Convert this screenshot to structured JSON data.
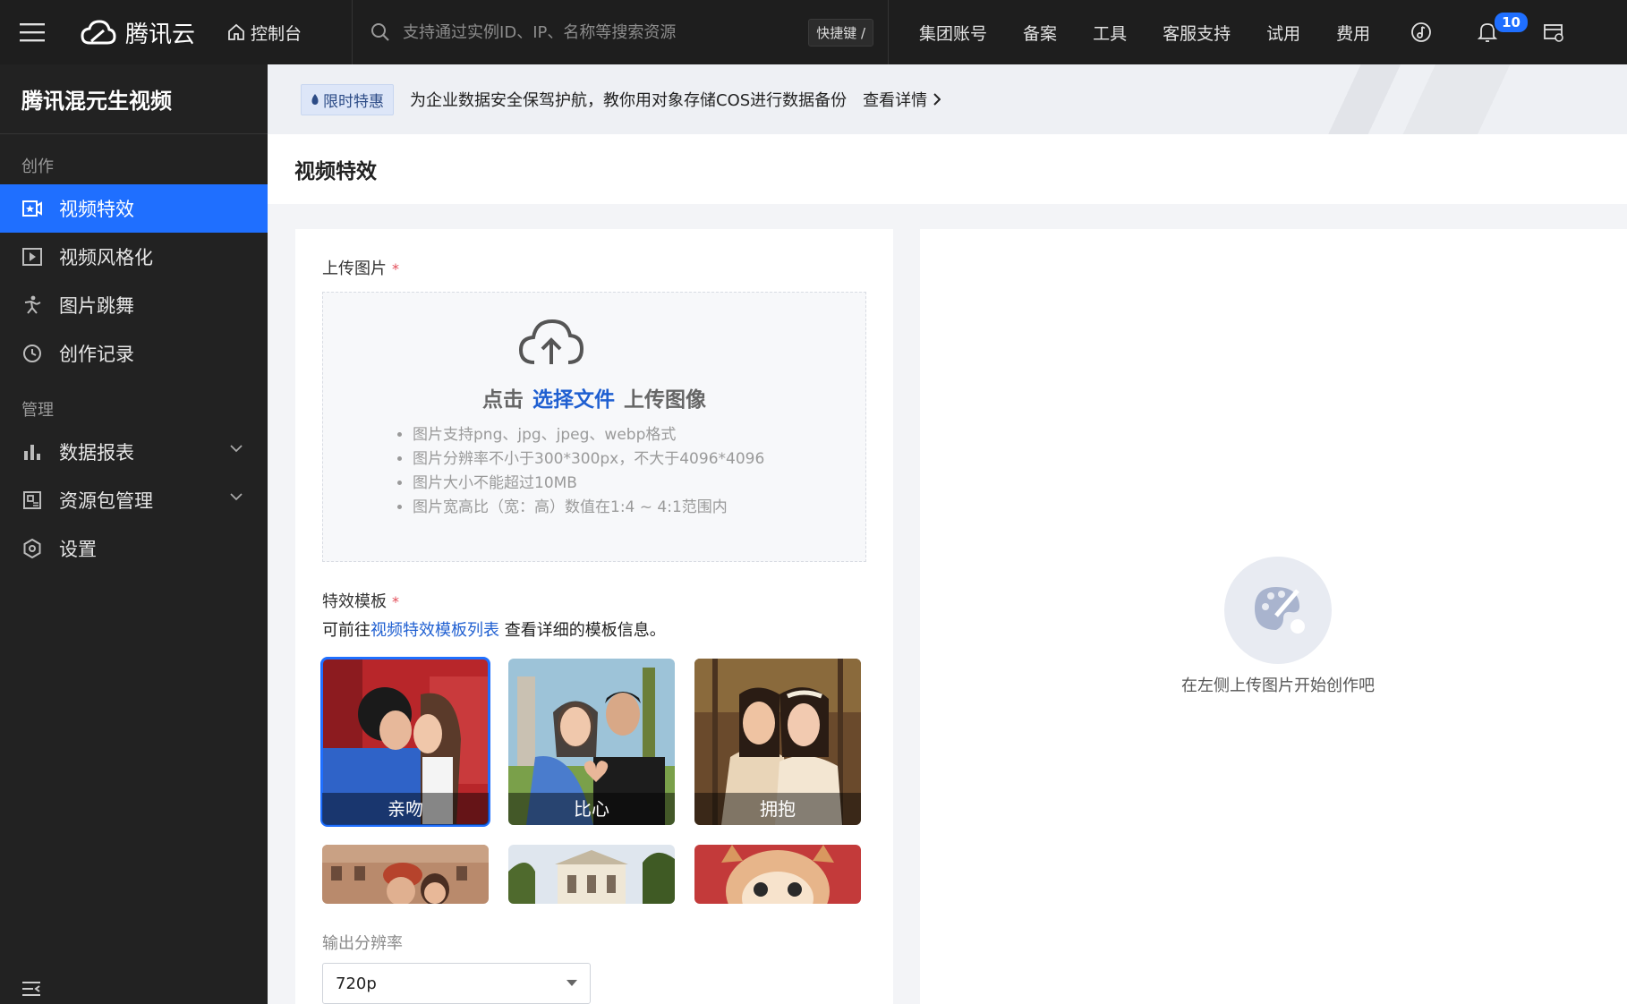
{
  "topbar": {
    "logo_text": "腾讯云",
    "console_label": "控制台",
    "search_placeholder": "支持通过实例ID、IP、名称等搜索资源",
    "shortcut_label": "快捷键 /",
    "nav": [
      "集团账号",
      "备案",
      "工具",
      "客服支持",
      "试用",
      "费用"
    ],
    "notification_count": "10"
  },
  "sidebar": {
    "title": "腾讯混元生视频",
    "group_create": "创作",
    "items_create": [
      {
        "label": "视频特效",
        "icon": "video-effect-icon",
        "active": true
      },
      {
        "label": "视频风格化",
        "icon": "video-play-icon",
        "active": false
      },
      {
        "label": "图片跳舞",
        "icon": "dancer-icon",
        "active": false
      },
      {
        "label": "创作记录",
        "icon": "history-icon",
        "active": false
      }
    ],
    "group_manage": "管理",
    "items_manage": [
      {
        "label": "数据报表",
        "icon": "bar-chart-icon",
        "expandable": true
      },
      {
        "label": "资源包管理",
        "icon": "package-icon",
        "expandable": true
      },
      {
        "label": "设置",
        "icon": "settings-icon",
        "expandable": false
      }
    ]
  },
  "promo": {
    "tag": "限时特惠",
    "text": "为企业数据安全保驾护航，教你用对象存储COS进行数据备份",
    "link": "查看详情"
  },
  "page": {
    "title": "视频特效"
  },
  "form": {
    "upload_label": "上传图片",
    "required_mark": "*",
    "upload_prefix": "点击",
    "upload_pick": "选择文件",
    "upload_suffix": "上传图像",
    "upload_tips": [
      "图片支持png、jpg、jpeg、webp格式",
      "图片分辨率不小于300*300px，不大于4096*4096",
      "图片大小不能超过10MB",
      "图片宽高比（宽：高）数值在1:4 ~ 4:1范围内"
    ],
    "template_label": "特效模板",
    "template_hint_prefix": "可前往",
    "template_hint_link": "视频特效模板列表",
    "template_hint_suffix": " 查看详细的模板信息。",
    "templates": [
      {
        "caption": "亲吻",
        "selected": true
      },
      {
        "caption": "比心",
        "selected": false
      },
      {
        "caption": "拥抱",
        "selected": false
      }
    ],
    "resolution_label": "输出分辨率",
    "resolution_value": "720p"
  },
  "preview": {
    "empty_text": "在左侧上传图片开始创作吧"
  }
}
